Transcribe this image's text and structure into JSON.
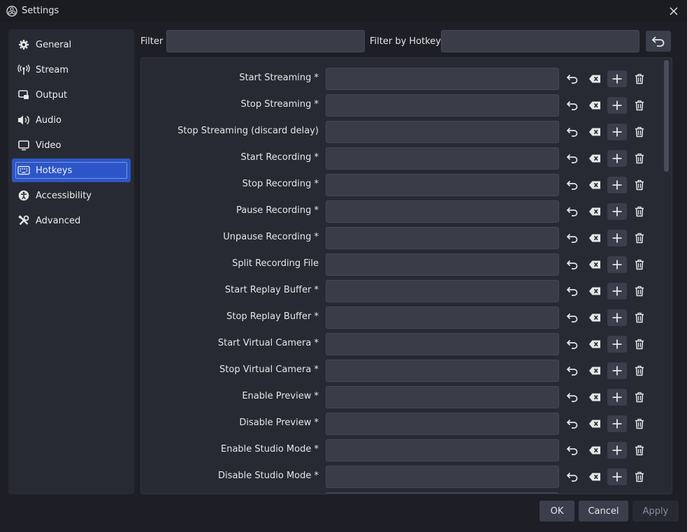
{
  "window": {
    "title": "Settings"
  },
  "sidebar": {
    "items": [
      {
        "label": "General",
        "icon": "gear-icon"
      },
      {
        "label": "Stream",
        "icon": "antenna-icon"
      },
      {
        "label": "Output",
        "icon": "output-icon"
      },
      {
        "label": "Audio",
        "icon": "speaker-icon"
      },
      {
        "label": "Video",
        "icon": "monitor-icon"
      },
      {
        "label": "Hotkeys",
        "icon": "keyboard-icon",
        "selected": true
      },
      {
        "label": "Accessibility",
        "icon": "accessibility-icon"
      },
      {
        "label": "Advanced",
        "icon": "tools-icon"
      }
    ]
  },
  "filter": {
    "label": "Filter",
    "value": "",
    "hotkey_label": "Filter by Hotkey",
    "hotkey_value": ""
  },
  "hotkeys": [
    {
      "label": "Start Streaming *",
      "value": ""
    },
    {
      "label": "Stop Streaming *",
      "value": ""
    },
    {
      "label": "Stop Streaming (discard delay)",
      "value": ""
    },
    {
      "label": "Start Recording *",
      "value": ""
    },
    {
      "label": "Stop Recording *",
      "value": ""
    },
    {
      "label": "Pause Recording *",
      "value": ""
    },
    {
      "label": "Unpause Recording *",
      "value": ""
    },
    {
      "label": "Split Recording File",
      "value": ""
    },
    {
      "label": "Start Replay Buffer *",
      "value": ""
    },
    {
      "label": "Stop Replay Buffer *",
      "value": ""
    },
    {
      "label": "Start Virtual Camera *",
      "value": ""
    },
    {
      "label": "Stop Virtual Camera *",
      "value": ""
    },
    {
      "label": "Enable Preview *",
      "value": ""
    },
    {
      "label": "Disable Preview *",
      "value": ""
    },
    {
      "label": "Enable Studio Mode *",
      "value": ""
    },
    {
      "label": "Disable Studio Mode *",
      "value": ""
    },
    {
      "label": "",
      "value": ""
    }
  ],
  "footer": {
    "ok": "OK",
    "cancel": "Cancel",
    "apply": "Apply"
  },
  "colors": {
    "accent": "#2c56c8",
    "background": "#1e1f26",
    "panel": "#272a33",
    "field": "#3a3c48"
  }
}
